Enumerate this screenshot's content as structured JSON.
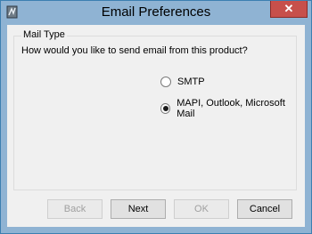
{
  "window": {
    "title": "Email Preferences",
    "close_label": "✕"
  },
  "group": {
    "legend": "Mail Type",
    "question": "How would you like to send email from this product?"
  },
  "options": [
    {
      "label": "SMTP",
      "selected": false
    },
    {
      "label": "MAPI, Outlook, Microsoft Mail",
      "selected": true
    }
  ],
  "buttons": {
    "back": "Back",
    "next": "Next",
    "ok": "OK",
    "cancel": "Cancel"
  },
  "colors": {
    "frame": "#8fb3d3",
    "close_button": "#c7504b",
    "client_background": "#f0f0f0"
  }
}
